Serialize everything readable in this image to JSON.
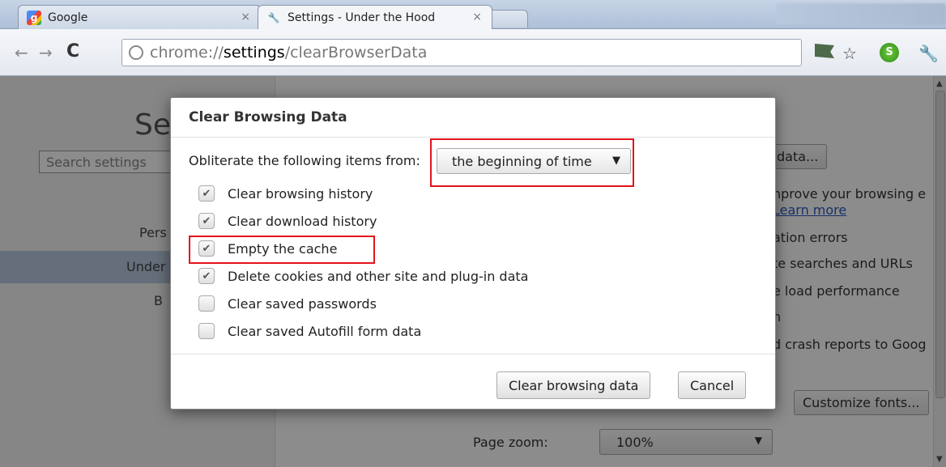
{
  "tabs": [
    {
      "title": "Google",
      "close": "×",
      "icon": "google-icon"
    },
    {
      "title": "Settings - Under the Hood",
      "close": "×",
      "icon": "wrench-icon"
    }
  ],
  "toolbar": {
    "back": "←",
    "forward": "→",
    "reload": "C",
    "url_scheme": "chrome://",
    "url_host": "settings",
    "url_path": "/clearBrowserData",
    "star": "☆",
    "ext": "S",
    "wrench": "🔧"
  },
  "settings_page": {
    "title": "Se",
    "search_placeholder": "Search settings",
    "nav": {
      "personal": "Pers",
      "under": "Under",
      "basics": "B"
    },
    "right": {
      "clear_data_button": "data...",
      "improve_text": "nprove your browsing e",
      "learn_more": "Learn more",
      "nav_errors": "ation errors",
      "suggest": "te searches and URLs",
      "prefetch": "e load performance",
      "phishing": "n",
      "crash": "d crash reports to Goog",
      "customize_fonts": "Customize fonts...",
      "page_zoom_label": "Page zoom:",
      "page_zoom_value": "100%"
    }
  },
  "dialog": {
    "title": "Clear Browsing Data",
    "from_label": "Obliterate the following items from:",
    "time_range": "the beginning of time",
    "items": [
      {
        "label": "Clear browsing history",
        "checked": true
      },
      {
        "label": "Clear download history",
        "checked": true
      },
      {
        "label": "Empty the cache",
        "checked": true
      },
      {
        "label": "Delete cookies and other site and plug-in data",
        "checked": true
      },
      {
        "label": "Clear saved passwords",
        "checked": false
      },
      {
        "label": "Clear saved Autofill form data",
        "checked": false
      }
    ],
    "clear_button": "Clear browsing data",
    "cancel_button": "Cancel"
  },
  "colors": {
    "highlight": "#e3141b",
    "selected_nav": "#b9c8de",
    "link": "#2a57c2"
  }
}
